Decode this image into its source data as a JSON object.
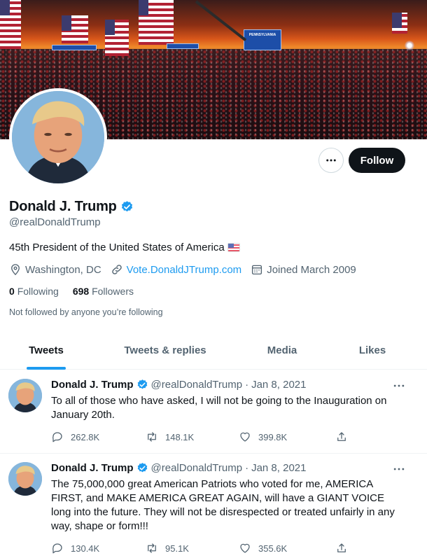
{
  "profile": {
    "display_name": "Donald J. Trump",
    "handle": "@realDonaldTrump",
    "bio": "45th President of the United States of America",
    "location": "Washington, DC",
    "website": "Vote.DonaldJTrump.com",
    "joined": "Joined March 2009",
    "following_count": "0",
    "following_label": "Following",
    "followers_count": "698",
    "followers_label": "Followers",
    "not_followed": "Not followed by anyone you’re following",
    "follow_label": "Follow"
  },
  "banner": {
    "sign_text": "PENNSYLVANIA"
  },
  "tabs": [
    {
      "label": "Tweets",
      "active": true
    },
    {
      "label": "Tweets & replies",
      "active": false
    },
    {
      "label": "Media",
      "active": false
    },
    {
      "label": "Likes",
      "active": false
    }
  ],
  "tweets": [
    {
      "name": "Donald J. Trump",
      "handle": "@realDonaldTrump",
      "dot": "·",
      "date": "Jan 8, 2021",
      "text": "To all of those who have asked, I will not be going to the Inauguration on January 20th.",
      "replies": "262.8K",
      "retweets": "148.1K",
      "likes": "399.8K"
    },
    {
      "name": "Donald J. Trump",
      "handle": "@realDonaldTrump",
      "dot": "·",
      "date": "Jan 8, 2021",
      "text": "The 75,000,000 great American Patriots who voted for me, AMERICA FIRST, and MAKE AMERICA GREAT AGAIN, will have a GIANT VOICE long into the future. They will not be disrespected or treated unfairly in any way, shape or form!!!",
      "replies": "130.4K",
      "retweets": "95.1K",
      "likes": "355.6K"
    }
  ],
  "colors": {
    "accent": "#1d9bf0",
    "text": "#0f1419",
    "secondary": "#536471",
    "follow_button": "#0f1419"
  },
  "icons": {
    "more": "more-horizontal-icon",
    "verified": "verified-badge-icon",
    "location": "location-pin-icon",
    "link": "link-icon",
    "calendar": "calendar-icon",
    "reply": "reply-icon",
    "retweet": "retweet-icon",
    "like": "heart-icon",
    "share": "share-icon"
  }
}
